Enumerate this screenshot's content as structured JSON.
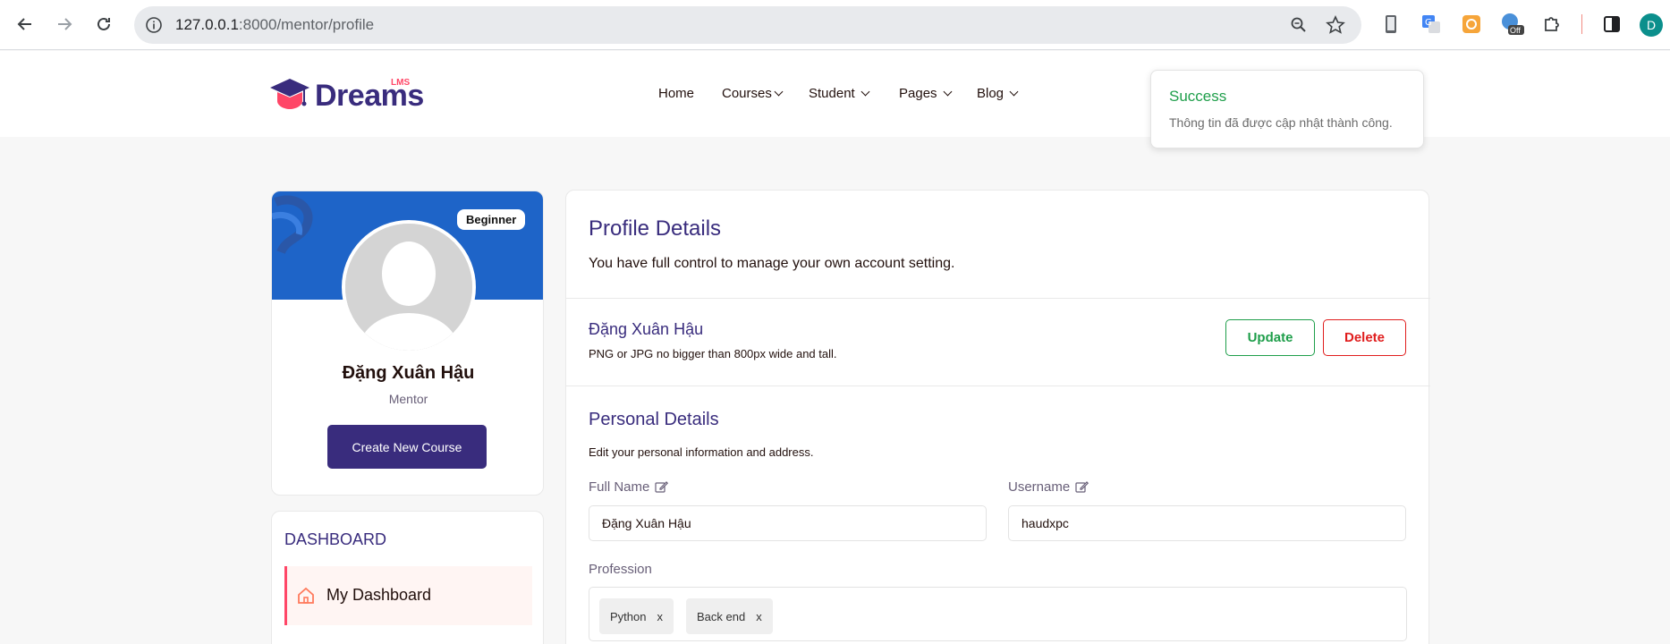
{
  "browser": {
    "url_host": "127.0.0.1",
    "url_path": ":8000/mentor/profile",
    "profile_initial": "D",
    "extension_badge": "Off"
  },
  "site": {
    "logo_text": "Dreams",
    "logo_badge": "LMS",
    "nav": [
      {
        "label": "Home"
      },
      {
        "label": "Courses"
      },
      {
        "label": "Student"
      },
      {
        "label": "Pages"
      },
      {
        "label": "Blog"
      }
    ]
  },
  "toast": {
    "title": "Success",
    "message": "Thông tin đã được cập nhật thành công."
  },
  "profile_card": {
    "level": "Beginner",
    "name": "Đặng Xuân Hậu",
    "role": "Mentor",
    "create_button": "Create New Course"
  },
  "dashboard": {
    "title": "DASHBOARD",
    "items": [
      {
        "label": "My Dashboard",
        "icon": "home-icon",
        "active": true
      }
    ]
  },
  "main": {
    "title": "Profile Details",
    "subtitle": "You have full control to manage your own account setting.",
    "avatar_section": {
      "name": "Đặng Xuân Hậu",
      "hint": "PNG or JPG no bigger than 800px wide and tall.",
      "update_label": "Update",
      "delete_label": "Delete"
    },
    "personal": {
      "title": "Personal Details",
      "subtitle": "Edit your personal information and address.",
      "full_name_label": "Full Name",
      "full_name_value": "Đặng Xuân Hậu",
      "username_label": "Username",
      "username_value": "haudxpc",
      "profession_label": "Profession",
      "professions": [
        {
          "label": "Python",
          "remove": "x"
        },
        {
          "label": "Back end",
          "remove": "x"
        }
      ]
    }
  },
  "colors": {
    "brand": "#392c7d",
    "accent": "#ff4667",
    "banner": "#1e64c8",
    "success": "#1e9e4a",
    "danger": "#e01d1d"
  }
}
